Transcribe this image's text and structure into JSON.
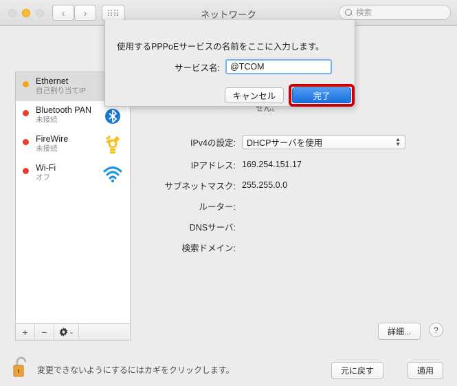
{
  "window": {
    "title": "ネットワーク",
    "traffic_lights": [
      "close",
      "minimize",
      "zoom"
    ],
    "nav_back": "‹",
    "nav_forward": "›"
  },
  "search": {
    "placeholder": "検索",
    "icon": "search-icon"
  },
  "sidebar": {
    "items": [
      {
        "name": "Ethernet",
        "status": "自己割り当てIP",
        "dot": "orange",
        "selected": true,
        "icon": "ethernet-icon"
      },
      {
        "name": "Bluetooth PAN",
        "status": "未接続",
        "dot": "red",
        "selected": false,
        "icon": "bluetooth-icon"
      },
      {
        "name": "FireWire",
        "status": "未接続",
        "dot": "red",
        "selected": false,
        "icon": "firewire-icon"
      },
      {
        "name": "Wi-Fi",
        "status": "オフ",
        "dot": "red",
        "selected": false,
        "icon": "wifi-icon"
      }
    ],
    "toolbar": {
      "add": "+",
      "remove": "−",
      "gear": "gear-icon",
      "gear_chevron": "⌄"
    }
  },
  "main": {
    "status_text": "スが設定されている\nせん。",
    "fields": [
      {
        "label": "IPv4の設定:",
        "value": "DHCPサーバを使用",
        "type": "select"
      },
      {
        "label": "IPアドレス:",
        "value": "169.254.151.17",
        "type": "text"
      },
      {
        "label": "サブネットマスク:",
        "value": "255.255.0.0",
        "type": "text"
      },
      {
        "label": "ルーター:",
        "value": "",
        "type": "text"
      },
      {
        "label": "DNSサーバ:",
        "value": "",
        "type": "text"
      },
      {
        "label": "検索ドメイン:",
        "value": "",
        "type": "text"
      }
    ],
    "advanced_label": "詳細...",
    "help_label": "?"
  },
  "footer": {
    "lock_icon": "unlocked-padlock-icon",
    "lock_text": "変更できないようにするにはカギをクリックします。",
    "revert_label": "元に戻す",
    "apply_label": "適用"
  },
  "sheet": {
    "title": "使用するPPPoEサービスの名前をここに入力します。",
    "field_label": "サービス名:",
    "field_value": "@TCOM",
    "cancel_label": "キャンセル",
    "done_label": "完了",
    "highlight_color": "#c60000",
    "default_button_color": "#1a6fe0"
  }
}
